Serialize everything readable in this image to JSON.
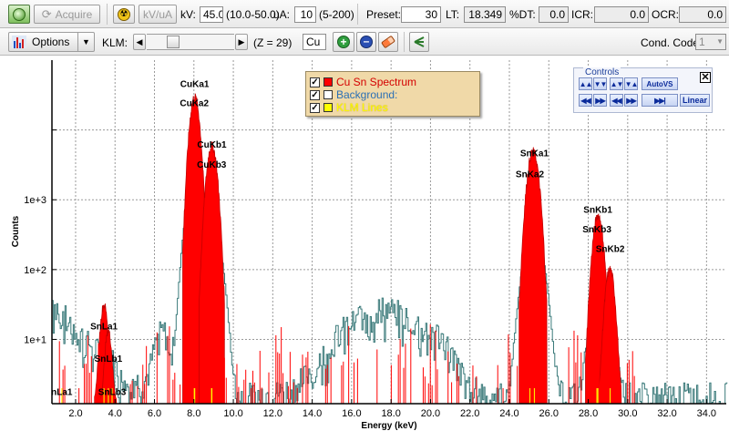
{
  "toolbar1": {
    "acquire_label": "Acquire",
    "kvua_label": "kV/uA",
    "kv_label": "kV:",
    "kv_value": "45.0",
    "kv_range": "(10.0-50.0)",
    "ua_label": "uA:",
    "ua_value": "10",
    "ua_range": "(5-200)",
    "preset_label": "Preset:",
    "preset_value": "30",
    "lt_label": "LT:",
    "lt_value": "18.349",
    "dt_label": "%DT:",
    "dt_value": "0.0",
    "icr_label": "ICR:",
    "icr_value": "0.0",
    "ocr_label": "OCR:",
    "ocr_value": "0.0"
  },
  "toolbar2": {
    "options_label": "Options",
    "klm_label": "KLM:",
    "klm_slider_fraction": 0.27,
    "z_readout": "(Z = 29)",
    "element_value": "Cu",
    "cond_code_label": "Cond. Code:",
    "cond_code_value": "1"
  },
  "legend": {
    "items": [
      {
        "label": "Cu Sn Spectrum",
        "color": "#ff0000",
        "text_color": "#d40000",
        "checked": true
      },
      {
        "label": "Background:",
        "color": "#ffffff",
        "text_color": "#2a6fb5",
        "checked": true
      },
      {
        "label": "KLM Lines",
        "color": "#ffff00",
        "text_color": "#ffff00",
        "checked": true
      }
    ]
  },
  "controls": {
    "title": "Controls",
    "autovs_label": "AutoVS",
    "linear_label": "Linear"
  },
  "chart_data": {
    "type": "area",
    "title": "",
    "xlabel": "Energy (keV)",
    "ylabel": "Counts",
    "xlim": [
      0.8,
      35.0
    ],
    "ylim": [
      0.12,
      10000
    ],
    "yscale": "log",
    "grid": true,
    "x_ticks": [
      "2.0",
      "4.0",
      "6.0",
      "8.0",
      "10.0",
      "12.0",
      "14.0",
      "16.0",
      "18.0",
      "20.0",
      "22.0",
      "24.0",
      "26.0",
      "28.0",
      "30.0",
      "32.0",
      "34.0"
    ],
    "x_tick_values": [
      2,
      4,
      6,
      8,
      10,
      12,
      14,
      16,
      18,
      20,
      22,
      24,
      26,
      28,
      30,
      32,
      34
    ],
    "y_ticks": [
      "1e+1",
      "1e+2",
      "1e+3"
    ],
    "y_tick_values": [
      1,
      10,
      100,
      1000
    ],
    "series": [
      {
        "name": "Cu Sn Spectrum",
        "color": "#ff0000",
        "peaks": [
          {
            "x": 3.44,
            "height": 3.0,
            "width": 0.15
          },
          {
            "x": 3.66,
            "height": 1.2,
            "width": 0.13
          },
          {
            "x": 8.04,
            "height": 3000,
            "width": 0.19
          },
          {
            "x": 8.91,
            "height": 600,
            "width": 0.2
          },
          {
            "x": 25.2,
            "height": 500,
            "width": 0.22
          },
          {
            "x": 28.5,
            "height": 60,
            "width": 0.2
          },
          {
            "x": 29.1,
            "height": 10,
            "width": 0.18
          }
        ]
      },
      {
        "name": "Background:",
        "color": "#3a7a7a"
      }
    ],
    "annotations": [
      {
        "label": "nLa1",
        "x": 1.3,
        "y": 0.16
      },
      {
        "label": "SnLa1",
        "x": 3.44,
        "y": 1.4
      },
      {
        "label": "SnLb1",
        "x": 3.66,
        "y": 0.48
      },
      {
        "label": "SnLb3",
        "x": 3.85,
        "y": 0.16
      },
      {
        "label": "CuKa1",
        "x": 8.04,
        "y": 4100
      },
      {
        "label": "CuKa2",
        "x": 8.02,
        "y": 2200
      },
      {
        "label": "CuKb1",
        "x": 8.91,
        "y": 560
      },
      {
        "label": "CuKb3",
        "x": 8.9,
        "y": 290
      },
      {
        "label": "SnKa1",
        "x": 25.27,
        "y": 420
      },
      {
        "label": "SnKa2",
        "x": 25.04,
        "y": 210
      },
      {
        "label": "SnKb1",
        "x": 28.49,
        "y": 65
      },
      {
        "label": "SnKb3",
        "x": 28.44,
        "y": 34
      },
      {
        "label": "SnKb2",
        "x": 29.11,
        "y": 18
      }
    ],
    "klm_lines": [
      1.3,
      3.44,
      3.66,
      3.85,
      8.04,
      8.02,
      8.91,
      8.9,
      25.27,
      25.04,
      28.49,
      28.44,
      29.11
    ],
    "klm_color": "#ffff00"
  }
}
